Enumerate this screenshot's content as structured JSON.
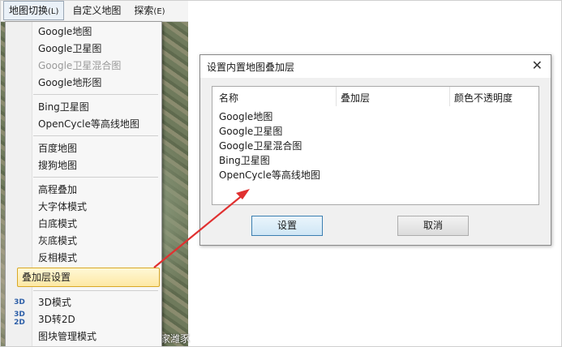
{
  "menubar": {
    "items": [
      {
        "label": "地图切换",
        "accel": "(L)"
      },
      {
        "label": "自定义地图",
        "accel": ""
      },
      {
        "label": "探索",
        "accel": "(E)"
      }
    ]
  },
  "dropdown": {
    "items": [
      {
        "label": "Google地图"
      },
      {
        "label": "Google卫星图"
      },
      {
        "label": "Google卫星混合图"
      },
      {
        "label": "Google地形图"
      },
      {
        "label": "Bing卫星图"
      },
      {
        "label": "OpenCycle等高线地图"
      },
      {
        "label": "百度地图"
      },
      {
        "label": "搜狗地图"
      },
      {
        "label": "高程叠加"
      },
      {
        "label": "大字体模式"
      },
      {
        "label": "白底模式"
      },
      {
        "label": "灰底模式"
      },
      {
        "label": "反相模式"
      },
      {
        "label": "叠加层设置"
      },
      {
        "label": "3D模式",
        "icon": "3D"
      },
      {
        "label": "3D转2D",
        "icon": "3D 2D"
      },
      {
        "label": "图块管理模式"
      }
    ]
  },
  "background": {
    "label": "家潍豕"
  },
  "dialog": {
    "title": "设置内置地图叠加层",
    "close": "✕",
    "columns": [
      "名称",
      "叠加层",
      "颜色不透明度"
    ],
    "rows": [
      "Google地图",
      "Google卫星图",
      "Google卫星混合图",
      "Bing卫星图",
      "OpenCycle等高线地图"
    ],
    "ok_label": "设置",
    "cancel_label": "取消"
  },
  "colors": {
    "arrow": "#e03030",
    "highlight_border": "#d9a825",
    "accent": "#3c7fb1"
  }
}
